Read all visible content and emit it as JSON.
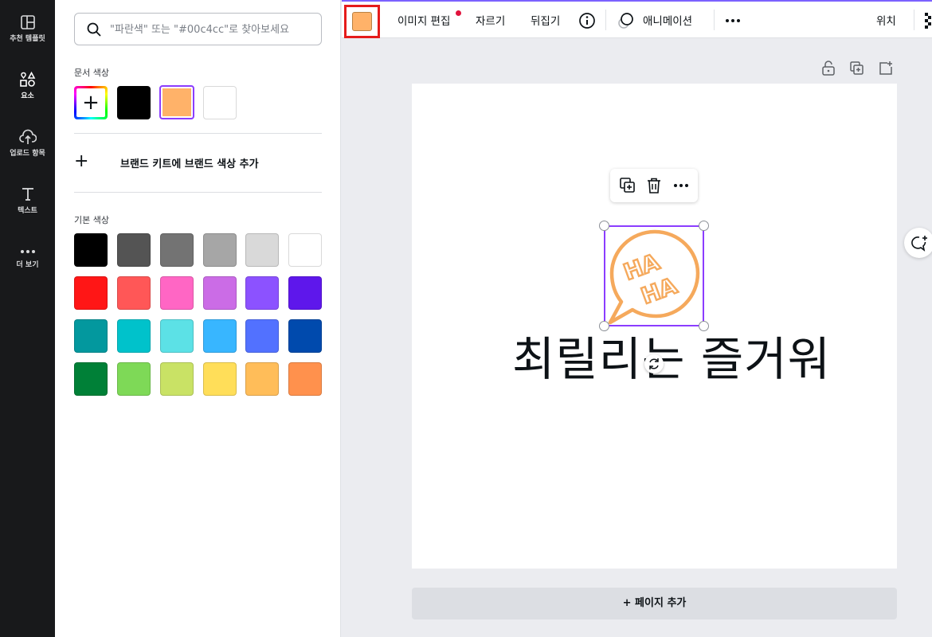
{
  "sidebar": {
    "items": [
      {
        "label": "추천 템플릿",
        "icon": "layout-icon"
      },
      {
        "label": "요소",
        "icon": "shapes-icon"
      },
      {
        "label": "업로드 항목",
        "icon": "cloud-upload-icon"
      },
      {
        "label": "텍스트",
        "icon": "text-icon"
      },
      {
        "label": "더 보기",
        "icon": "more-icon"
      }
    ]
  },
  "panel": {
    "search_placeholder": "\"파란색\" 또는 \"#00c4cc\"로 찾아보세요",
    "document_colors_title": "문서 색상",
    "document_colors": [
      "#000000",
      "#ffb269",
      "#ffffff"
    ],
    "brand_kit_label": "브랜드 키트에 브랜드 색상 추가",
    "default_colors_title": "기본 색상",
    "default_colors": [
      [
        "#000000",
        "#545454",
        "#737373",
        "#a6a6a6",
        "#d9d9d9",
        "#ffffff"
      ],
      [
        "#ff1616",
        "#ff5757",
        "#ff66c4",
        "#cb6ce6",
        "#8c52ff",
        "#5e17eb"
      ],
      [
        "#03989e",
        "#00c2cb",
        "#5ce1e6",
        "#38b6ff",
        "#5271ff",
        "#004aad"
      ],
      [
        "#008037",
        "#7ed957",
        "#c9e265",
        "#ffde59",
        "#ffbd59",
        "#ff914d"
      ]
    ]
  },
  "toolbar": {
    "current_color": "#ffb269",
    "edit_image": "이미지 편집",
    "crop": "자르기",
    "flip": "뒤집기",
    "animate": "애니메이션",
    "position": "위치"
  },
  "canvas": {
    "main_text": "최릴리는 즐거워",
    "add_page": "+ 페이지 추가",
    "sticker_text": "HA HA"
  },
  "colors": {
    "accent": "#8b3dff",
    "highlight": "#e51b1b",
    "sticker": "#f5a95c"
  }
}
